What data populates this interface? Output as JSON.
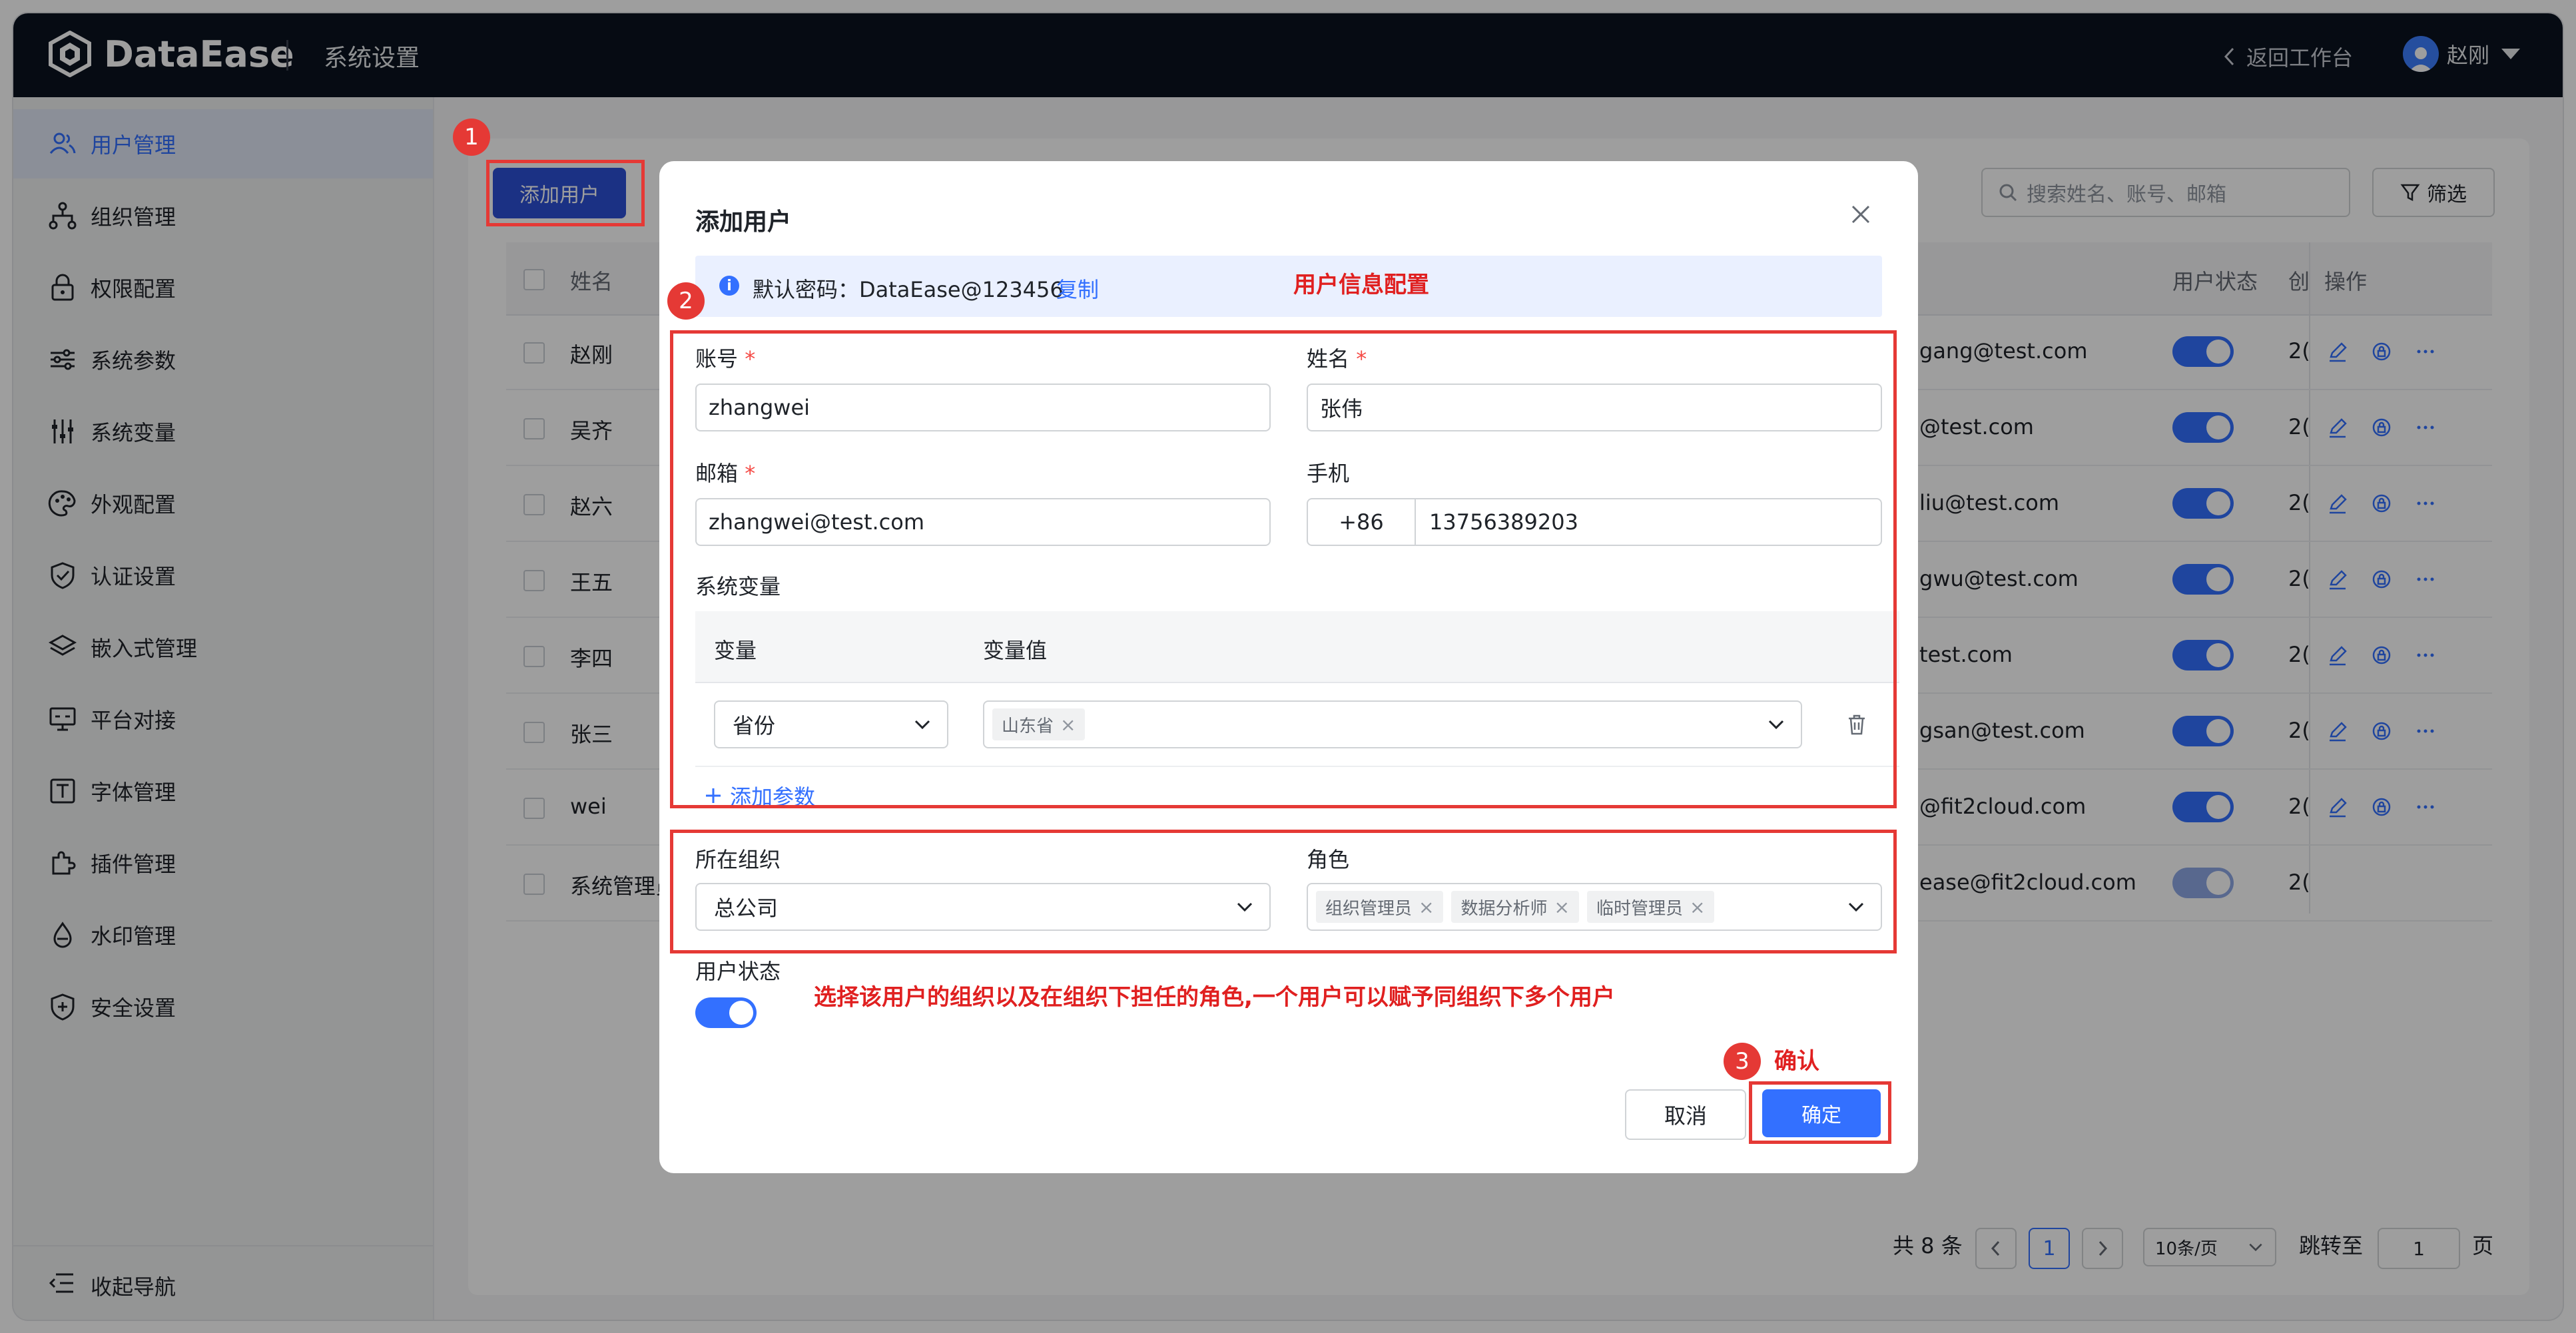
{
  "app": {
    "name": "DataEase",
    "section_title": "系统设置",
    "back_label": "返回工作台",
    "user_name": "赵刚"
  },
  "sidebar": {
    "items": [
      {
        "label": "用户管理",
        "icon": "users-icon",
        "active": true
      },
      {
        "label": "组织管理",
        "icon": "org-tree-icon"
      },
      {
        "label": "权限配置",
        "icon": "lock-icon"
      },
      {
        "label": "系统参数",
        "icon": "sliders-icon"
      },
      {
        "label": "系统变量",
        "icon": "variables-icon"
      },
      {
        "label": "外观配置",
        "icon": "palette-icon"
      },
      {
        "label": "认证设置",
        "icon": "shield-check-icon"
      },
      {
        "label": "嵌入式管理",
        "icon": "layers-icon"
      },
      {
        "label": "平台对接",
        "icon": "monitor-icon"
      },
      {
        "label": "字体管理",
        "icon": "font-icon"
      },
      {
        "label": "插件管理",
        "icon": "plugin-icon"
      },
      {
        "label": "水印管理",
        "icon": "drop-icon"
      },
      {
        "label": "安全设置",
        "icon": "shield-plus-icon"
      }
    ],
    "collapse_label": "收起导航"
  },
  "toolbar": {
    "add_user_label": "添加用户",
    "search_placeholder": "搜索姓名、账号、邮箱",
    "filter_label": "筛选"
  },
  "table": {
    "headers": {
      "name": "姓名",
      "status": "用户状态",
      "created": "创",
      "actions": "操作"
    },
    "rows": [
      {
        "name": "赵刚",
        "email": "gang@test.com",
        "created": "2(",
        "status_on": true
      },
      {
        "name": "吴齐",
        "email": "@test.com",
        "created": "2(",
        "status_on": true
      },
      {
        "name": "赵六",
        "email": "liu@test.com",
        "created": "2(",
        "status_on": true
      },
      {
        "name": "王五",
        "email": "gwu@test.com",
        "created": "2(",
        "status_on": true
      },
      {
        "name": "李四",
        "email": "test.com",
        "created": "2(",
        "status_on": true
      },
      {
        "name": "张三",
        "email": "gsan@test.com",
        "created": "2(",
        "status_on": true
      },
      {
        "name": "wei",
        "email": "@fit2cloud.com",
        "created": "2(",
        "status_on": true
      },
      {
        "name": "系统管理员",
        "email": "ease@fit2cloud.com",
        "created": "2(",
        "status_on": true,
        "disabled": true
      }
    ]
  },
  "pagination": {
    "total_label": "共 8 条",
    "current_page": "1",
    "page_size": "10条/页",
    "jump_label": "跳转至",
    "jump_value": "1",
    "page_suffix": "页"
  },
  "modal": {
    "title": "添加用户",
    "info_text": "默认密码：DataEase@123456",
    "copy_label": "复制",
    "account_label": "账号",
    "account_value": "zhangwei",
    "name_label": "姓名",
    "name_value": "张伟",
    "email_label": "邮箱",
    "email_value": "zhangwei@test.com",
    "phone_label": "手机",
    "phone_prefix": "+86",
    "phone_value": "13756389203",
    "sysvar_label": "系统变量",
    "var_col": "变量",
    "var_value_col": "变量值",
    "var_name": "省份",
    "var_tag": "山东省",
    "add_param_label": "添加参数",
    "org_label": "所在组织",
    "org_value": "总公司",
    "role_label": "角色",
    "role_tags": [
      "组织管理员",
      "数据分析师",
      "临时管理员"
    ],
    "status_label": "用户状态",
    "status_on": true,
    "cancel_label": "取消",
    "ok_label": "确定"
  },
  "annotations": {
    "marker_1": "1",
    "marker_2": "2",
    "marker_3": "3",
    "user_info_note": "用户信息配置",
    "org_role_note": "选择该用户的组织以及在组织下担任的角色,一个用户可以赋予同组织下多个用户",
    "confirm_note": "确认"
  },
  "colors": {
    "primary": "#3370ff",
    "topbar": "#0b1220",
    "annotation_red": "#e53935"
  }
}
